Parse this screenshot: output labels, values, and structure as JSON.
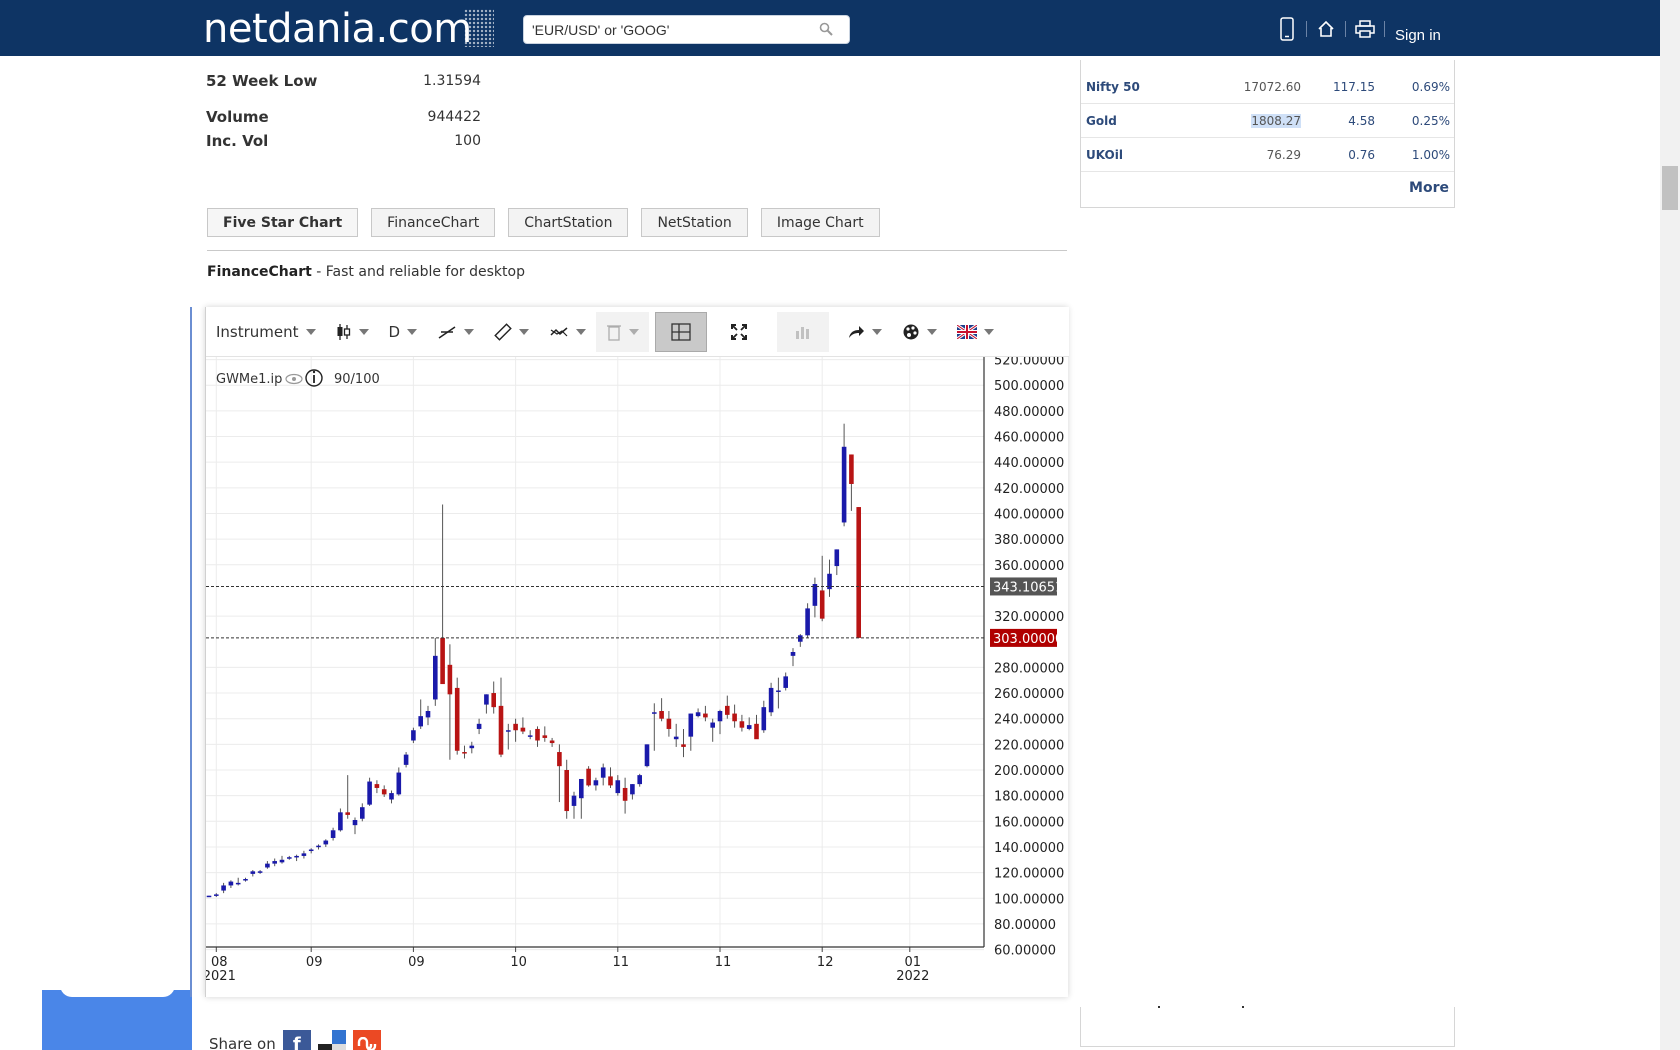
{
  "header": {
    "logo": "netdania.com",
    "search_placeholder": "'EUR/USD' or 'GOOG'",
    "signin": "Sign in",
    "icons": [
      "mobile-icon",
      "home-icon",
      "print-icon"
    ]
  },
  "stats": [
    {
      "label": "52 Week Low",
      "value": "1.31594"
    },
    {
      "label": "Volume",
      "value": "944422"
    },
    {
      "label": "Inc. Vol",
      "value": "100"
    }
  ],
  "chart_tabs": [
    "Five Star Chart",
    "FinanceChart",
    "ChartStation",
    "NetStation",
    "Image Chart"
  ],
  "financechart": {
    "name": "FinanceChart",
    "desc": " - Fast and reliable for desktop"
  },
  "toolbar": {
    "instrument": "Instrument",
    "period": "D"
  },
  "chart_info": {
    "symbol": "GWMe1.ip",
    "count": "90/100"
  },
  "markets": [
    {
      "name": "Nifty 50",
      "last": "17072.60",
      "chg": "117.15",
      "pct": "0.69%"
    },
    {
      "name": "Gold",
      "last": "1808.27",
      "chg": "4.58",
      "pct": "0.25%"
    },
    {
      "name": "UKOil",
      "last": "76.29",
      "chg": "0.76",
      "pct": "1.00%"
    }
  ],
  "more": "More",
  "share": {
    "label": "Share on",
    "buttons": [
      "f",
      "del",
      "su"
    ]
  },
  "colors": {
    "header_bg": "#0e3464",
    "up": "#1a1aaa",
    "down": "#b81414",
    "link": "#2d4a7a"
  },
  "chart_data": {
    "type": "candlestick",
    "ylim": [
      60,
      520
    ],
    "y_ticks": [
      "520.00000",
      "500.00000",
      "480.00000",
      "460.00000",
      "440.00000",
      "420.00000",
      "400.00000",
      "380.00000",
      "360.00000",
      "320.00000",
      "280.00000",
      "260.00000",
      "240.00000",
      "220.00000",
      "200.00000",
      "180.00000",
      "160.00000",
      "140.00000",
      "120.00000",
      "100.00000",
      "80.00000",
      "60.00000"
    ],
    "x_ticks": [
      {
        "m": "08",
        "y": "2021",
        "i": 1
      },
      {
        "m": "09",
        "y": "",
        "i": 14
      },
      {
        "m": "09",
        "y": "",
        "i": 28
      },
      {
        "m": "10",
        "y": "",
        "i": 42
      },
      {
        "m": "11",
        "y": "",
        "i": 56
      },
      {
        "m": "11",
        "y": "",
        "i": 70
      },
      {
        "m": "12",
        "y": "",
        "i": 84
      },
      {
        "m": "01",
        "y": "2022",
        "i": 96
      }
    ],
    "markers": [
      {
        "label": "343.10651",
        "value": 343.1,
        "kind": "gray"
      },
      {
        "label": "303.00000",
        "value": 303.0,
        "kind": "red"
      }
    ],
    "candles": [
      [
        101,
        102,
        101,
        102
      ],
      [
        102,
        104,
        101,
        103
      ],
      [
        106,
        112,
        104,
        110
      ],
      [
        110,
        114,
        108,
        113
      ],
      [
        112,
        116,
        110,
        112
      ],
      [
        114,
        116,
        113,
        115
      ],
      [
        119,
        122,
        117,
        121
      ],
      [
        120,
        122,
        119,
        121
      ],
      [
        124,
        129,
        123,
        127
      ],
      [
        127,
        131,
        125,
        129
      ],
      [
        128,
        133,
        127,
        130
      ],
      [
        131,
        133,
        130,
        132
      ],
      [
        132,
        134,
        129,
        133
      ],
      [
        133,
        137,
        131,
        135
      ],
      [
        137,
        139,
        135,
        138
      ],
      [
        140,
        142,
        138,
        141
      ],
      [
        142,
        146,
        140,
        145
      ],
      [
        147,
        155,
        145,
        153
      ],
      [
        153,
        170,
        152,
        167
      ],
      [
        167,
        196,
        162,
        165
      ],
      [
        157,
        163,
        150,
        161
      ],
      [
        162,
        174,
        160,
        171
      ],
      [
        173,
        194,
        172,
        191
      ],
      [
        189,
        192,
        182,
        186
      ],
      [
        185,
        188,
        179,
        181
      ],
      [
        177,
        184,
        174,
        182
      ],
      [
        181,
        202,
        180,
        198
      ],
      [
        204,
        214,
        202,
        212
      ],
      [
        223,
        233,
        221,
        231
      ],
      [
        234,
        255,
        232,
        242
      ],
      [
        241,
        250,
        235,
        246
      ],
      [
        255,
        303,
        250,
        289
      ],
      [
        303,
        407,
        282,
        267
      ],
      [
        282,
        298,
        208,
        259
      ],
      [
        264,
        272,
        212,
        215
      ],
      [
        214,
        219,
        209,
        213
      ],
      [
        217,
        222,
        213,
        219
      ],
      [
        232,
        240,
        228,
        236
      ],
      [
        251,
        259,
        244,
        259
      ],
      [
        260,
        269,
        244,
        249
      ],
      [
        250,
        272,
        210,
        212
      ],
      [
        230,
        236,
        216,
        231
      ],
      [
        236,
        240,
        222,
        231
      ],
      [
        233,
        241,
        228,
        230
      ],
      [
        226,
        231,
        224,
        227
      ],
      [
        232,
        234,
        218,
        223
      ],
      [
        227,
        234,
        222,
        225
      ],
      [
        223,
        225,
        218,
        221
      ],
      [
        214,
        220,
        175,
        203
      ],
      [
        200,
        208,
        162,
        168
      ],
      [
        172,
        183,
        162,
        180
      ],
      [
        178,
        193,
        162,
        193
      ],
      [
        201,
        203,
        187,
        188
      ],
      [
        188,
        194,
        184,
        192
      ],
      [
        194,
        205,
        188,
        202
      ],
      [
        195,
        202,
        186,
        188
      ],
      [
        182,
        196,
        180,
        192
      ],
      [
        186,
        194,
        166,
        176
      ],
      [
        181,
        189,
        177,
        189
      ],
      [
        189,
        197,
        187,
        196
      ],
      [
        203,
        220,
        202,
        220
      ],
      [
        245,
        252,
        215,
        245
      ],
      [
        246,
        256,
        238,
        240
      ],
      [
        240,
        246,
        226,
        232
      ],
      [
        224,
        236,
        218,
        226
      ],
      [
        220,
        232,
        210,
        218
      ],
      [
        226,
        244,
        215,
        244
      ],
      [
        242,
        248,
        241,
        245
      ],
      [
        244,
        250,
        238,
        241
      ],
      [
        233,
        240,
        222,
        237
      ],
      [
        238,
        247,
        228,
        246
      ],
      [
        250,
        258,
        240,
        243
      ],
      [
        244,
        251,
        233,
        238
      ],
      [
        238,
        243,
        230,
        233
      ],
      [
        232,
        241,
        231,
        235
      ],
      [
        236,
        243,
        226,
        224
      ],
      [
        231,
        254,
        229,
        249
      ],
      [
        245,
        268,
        242,
        264
      ],
      [
        262,
        272,
        248,
        262
      ],
      [
        264,
        276,
        262,
        273
      ],
      [
        289,
        295,
        281,
        292
      ],
      [
        300,
        306,
        296,
        305
      ],
      [
        305,
        330,
        303,
        326
      ],
      [
        328,
        350,
        319,
        345
      ],
      [
        340,
        367,
        316,
        318
      ],
      [
        341,
        364,
        335,
        353
      ],
      [
        359,
        372,
        352,
        372
      ],
      [
        393,
        470,
        390,
        452
      ],
      [
        446,
        446,
        402,
        423
      ],
      [
        405,
        405,
        303,
        303
      ]
    ]
  }
}
